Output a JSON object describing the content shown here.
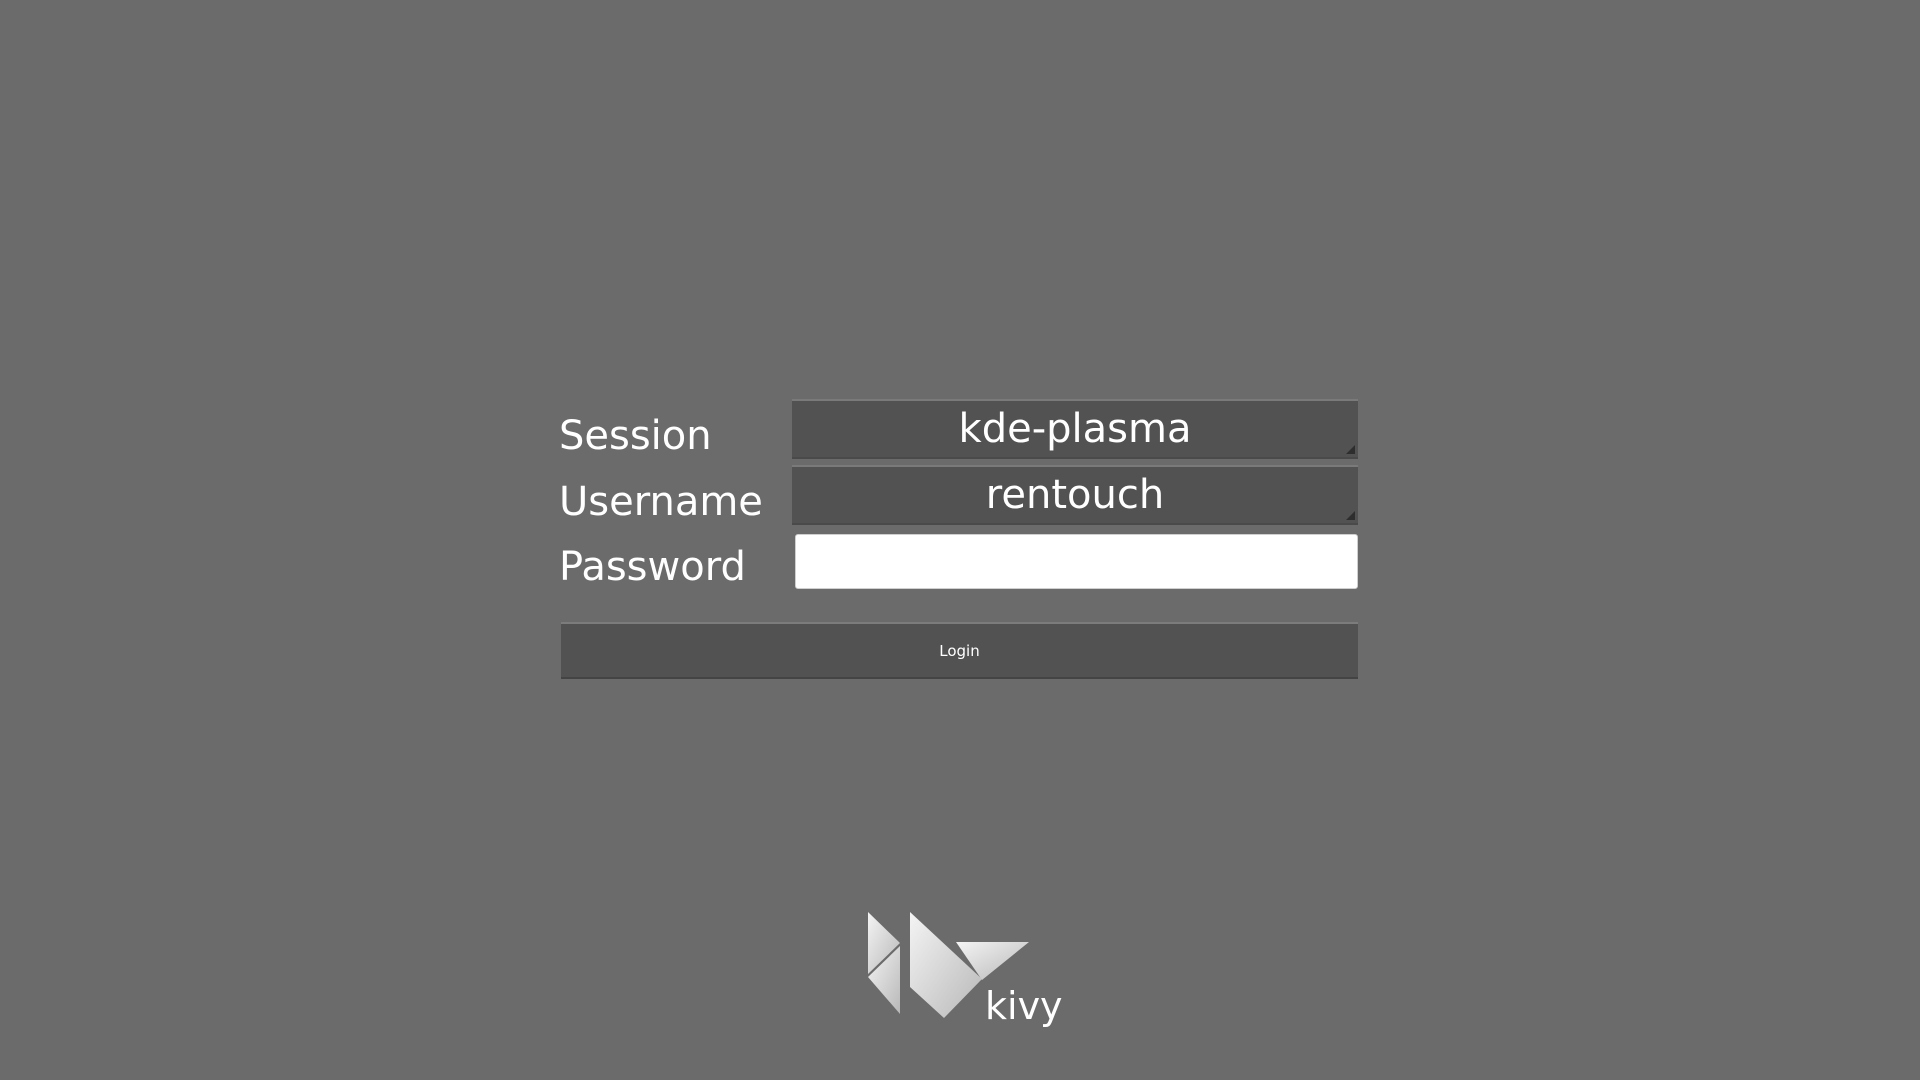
{
  "form": {
    "session_label": "Session",
    "username_label": "Username",
    "password_label": "Password",
    "session_value": "kde-plasma",
    "username_value": "rentouch",
    "password_value": "",
    "login_label": "Login"
  },
  "branding": {
    "logo_text": "kivy",
    "logo_icon": "kivy-logo-icon"
  },
  "colors": {
    "background": "#6b6b6b",
    "control": "#525252",
    "text": "#ffffff"
  }
}
